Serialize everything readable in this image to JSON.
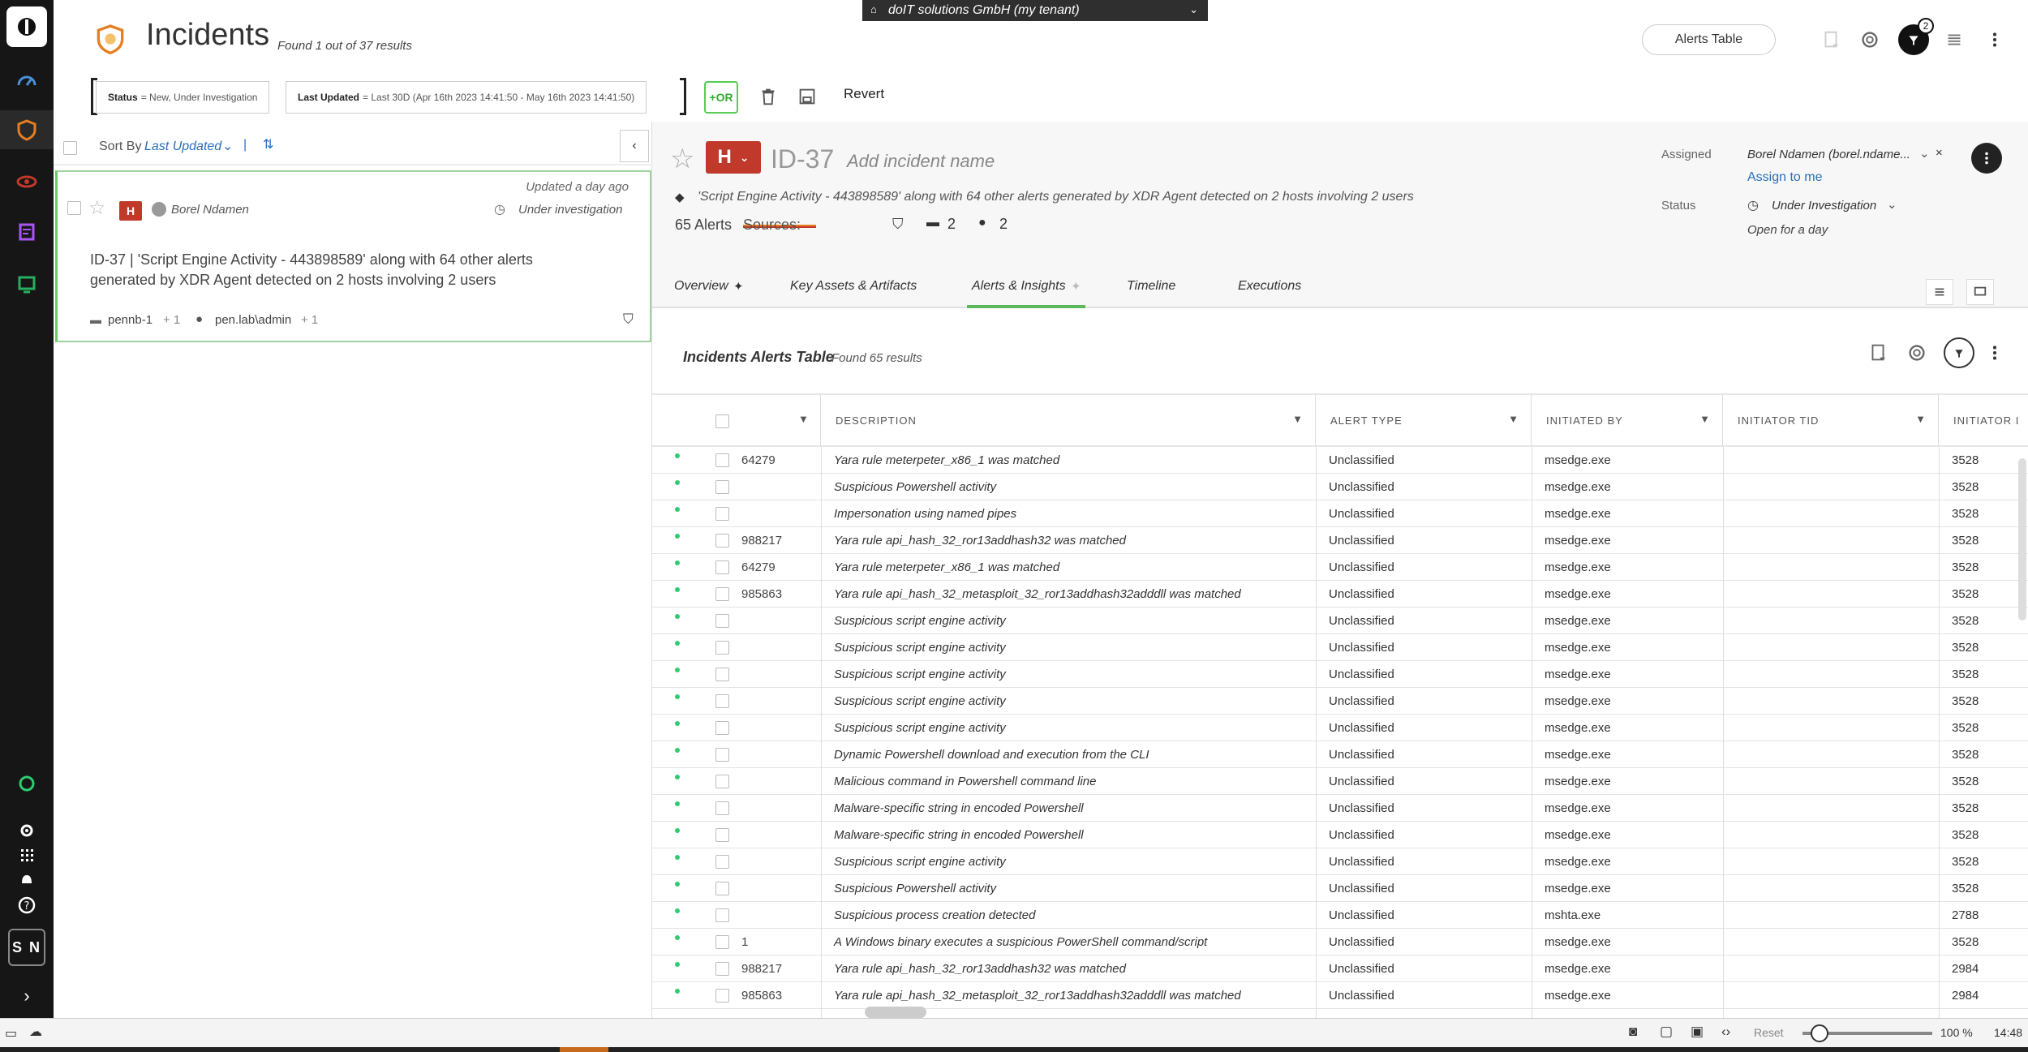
{
  "header": {
    "title": "Incidents",
    "found": "Found 1 out of 37 results",
    "tenant": "doIT solutions GmbH (my tenant)",
    "alerts_table_btn": "Alerts Table",
    "notif_count": "2"
  },
  "filters": {
    "status_key": "Status",
    "status_val": "= New, Under Investigation",
    "updated_key": "Last Updated",
    "updated_val": "= Last 30D (Apr 16th 2023 14:41:50 - May 16th 2023 14:41:50)",
    "or_label": "+OR",
    "revert": "Revert"
  },
  "list": {
    "sort_label": "Sort By",
    "sort_value": "Last Updated",
    "card": {
      "updated": "Updated a day ago",
      "severity": "H",
      "owner": "Borel Ndamen",
      "status": "Under investigation",
      "title_line1": "ID-37 | 'Script Engine Activity - 443898589' along with 64 other alerts",
      "title_line2": "generated by XDR Agent detected on 2 hosts involving 2 users",
      "host": "pennb-1",
      "host_more": "+ 1",
      "user": "pen.lab\\admin",
      "user_more": "+ 1"
    }
  },
  "detail": {
    "severity": "H",
    "id": "ID-37",
    "name_placeholder": "Add incident name",
    "description": "'Script Engine Activity - 443898589' along with 64 other alerts generated by XDR Agent detected on 2 hosts involving 2 users",
    "alerts_count": "65 Alerts",
    "sources_label": "Sources:",
    "hosts_count": "2",
    "users_count": "2",
    "assigned_label": "Assigned",
    "assigned_value": "Borel Ndamen (borel.ndame...",
    "assign_to_me": "Assign to me",
    "status_label": "Status",
    "status_value": "Under Investigation",
    "open_for": "Open for a day"
  },
  "tabs": [
    {
      "label": "Overview"
    },
    {
      "label": "Key Assets & Artifacts"
    },
    {
      "label": "Alerts & Insights"
    },
    {
      "label": "Timeline"
    },
    {
      "label": "Executions"
    }
  ],
  "table": {
    "title": "Incidents Alerts Table",
    "found": "Found 65 results",
    "columns": [
      "DESCRIPTION",
      "ALERT TYPE",
      "INITIATED BY",
      "INITIATOR TID",
      "INITIATOR I"
    ],
    "rows": [
      {
        "id": "64279",
        "desc": "Yara rule meterpeter_x86_1 was matched",
        "type": "Unclassified",
        "by": "msedge.exe",
        "tid": "",
        "pid": "3528"
      },
      {
        "id": "",
        "desc": "Suspicious Powershell activity",
        "type": "Unclassified",
        "by": "msedge.exe",
        "tid": "",
        "pid": "3528"
      },
      {
        "id": "",
        "desc": "Impersonation using named pipes",
        "type": "Unclassified",
        "by": "msedge.exe",
        "tid": "",
        "pid": "3528"
      },
      {
        "id": "988217",
        "desc": "Yara rule api_hash_32_ror13addhash32 was matched",
        "type": "Unclassified",
        "by": "msedge.exe",
        "tid": "",
        "pid": "3528"
      },
      {
        "id": "64279",
        "desc": "Yara rule meterpeter_x86_1 was matched",
        "type": "Unclassified",
        "by": "msedge.exe",
        "tid": "",
        "pid": "3528"
      },
      {
        "id": "985863",
        "desc": "Yara rule api_hash_32_metasploit_32_ror13addhash32adddll was matched",
        "type": "Unclassified",
        "by": "msedge.exe",
        "tid": "",
        "pid": "3528"
      },
      {
        "id": "",
        "desc": "Suspicious script engine activity",
        "type": "Unclassified",
        "by": "msedge.exe",
        "tid": "",
        "pid": "3528"
      },
      {
        "id": "",
        "desc": "Suspicious script engine activity",
        "type": "Unclassified",
        "by": "msedge.exe",
        "tid": "",
        "pid": "3528"
      },
      {
        "id": "",
        "desc": "Suspicious script engine activity",
        "type": "Unclassified",
        "by": "msedge.exe",
        "tid": "",
        "pid": "3528"
      },
      {
        "id": "",
        "desc": "Suspicious script engine activity",
        "type": "Unclassified",
        "by": "msedge.exe",
        "tid": "",
        "pid": "3528"
      },
      {
        "id": "",
        "desc": "Suspicious script engine activity",
        "type": "Unclassified",
        "by": "msedge.exe",
        "tid": "",
        "pid": "3528"
      },
      {
        "id": "",
        "desc": "Dynamic Powershell download and execution from the CLI",
        "type": "Unclassified",
        "by": "msedge.exe",
        "tid": "",
        "pid": "3528"
      },
      {
        "id": "",
        "desc": "Malicious command in Powershell command line",
        "type": "Unclassified",
        "by": "msedge.exe",
        "tid": "",
        "pid": "3528"
      },
      {
        "id": "",
        "desc": "Malware-specific string in encoded Powershell",
        "type": "Unclassified",
        "by": "msedge.exe",
        "tid": "",
        "pid": "3528"
      },
      {
        "id": "",
        "desc": "Malware-specific string in encoded Powershell",
        "type": "Unclassified",
        "by": "msedge.exe",
        "tid": "",
        "pid": "3528"
      },
      {
        "id": "",
        "desc": "Suspicious script engine activity",
        "type": "Unclassified",
        "by": "msedge.exe",
        "tid": "",
        "pid": "3528"
      },
      {
        "id": "",
        "desc": "Suspicious Powershell activity",
        "type": "Unclassified",
        "by": "msedge.exe",
        "tid": "",
        "pid": "3528"
      },
      {
        "id": "",
        "desc": "Suspicious process creation detected",
        "type": "Unclassified",
        "by": "mshta.exe",
        "tid": "",
        "pid": "2788"
      },
      {
        "id": "1",
        "desc": "A Windows binary executes a suspicious PowerShell command/script",
        "type": "Unclassified",
        "by": "msedge.exe",
        "tid": "",
        "pid": "3528"
      },
      {
        "id": "988217",
        "desc": "Yara rule api_hash_32_ror13addhash32 was matched",
        "type": "Unclassified",
        "by": "msedge.exe",
        "tid": "",
        "pid": "2984"
      },
      {
        "id": "985863",
        "desc": "Yara rule api_hash_32_metasploit_32_ror13addhash32adddll was matched",
        "type": "Unclassified",
        "by": "msedge.exe",
        "tid": "",
        "pid": "2984"
      }
    ]
  },
  "bottombar": {
    "reset": "Reset",
    "zoom": "100 %",
    "time": "14:48"
  },
  "nav": {
    "avatar": "S N"
  },
  "colors": {
    "severity_high": "#c0392b",
    "accent_green": "#5cb85c",
    "link_blue": "#2a6ebb"
  }
}
